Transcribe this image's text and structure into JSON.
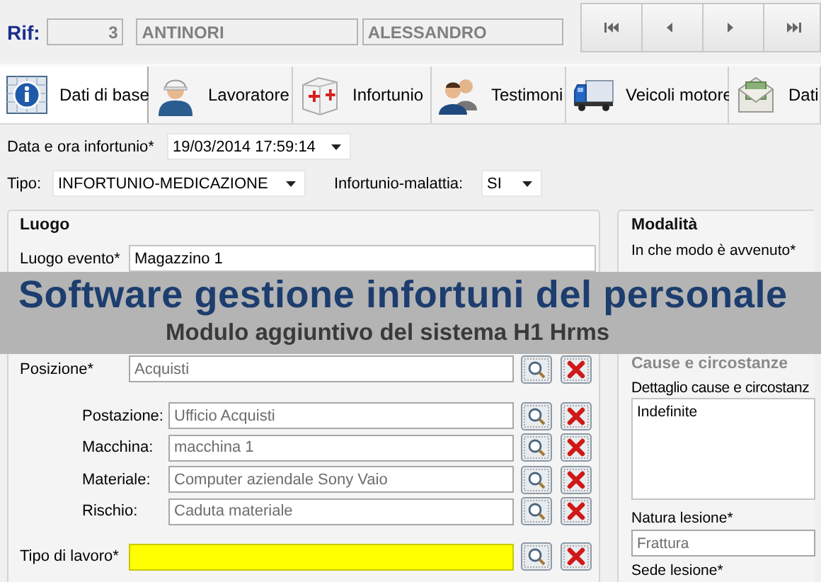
{
  "header": {
    "label": "Rif:",
    "number": "3",
    "surname": "ANTINORI",
    "name": "ALESSANDRO",
    "nav": [
      {
        "kind": "first"
      },
      {
        "kind": "prev"
      },
      {
        "kind": "next"
      },
      {
        "kind": "last"
      }
    ]
  },
  "tabs": [
    {
      "label": "Dati di base",
      "selected": true
    },
    {
      "label": "Lavoratore",
      "selected": false
    },
    {
      "label": "Infortunio",
      "selected": false
    },
    {
      "label": "Testimoni",
      "selected": false
    },
    {
      "label": "Veicoli motore",
      "selected": false
    },
    {
      "label": "Dati",
      "selected": false
    }
  ],
  "accident": {
    "date_label": "Data e ora infortunio*",
    "date_value": "19/03/2014 17:59:14",
    "type_label": "Tipo:",
    "type_value": "INFORTUNIO-MEDICAZIONE",
    "illness_label": "Infortunio-malattia:",
    "illness_value": "SI"
  },
  "place": {
    "title": "Luogo",
    "event_label": "Luogo evento*",
    "event_value": "Magazzino 1",
    "position_label": "Posizione*",
    "position_value": "Acquisti",
    "lookups": [
      {
        "label": "Postazione:",
        "value": "Ufficio Acquisti"
      },
      {
        "label": "Macchina:",
        "value": "macchina 1"
      },
      {
        "label": "Materiale:",
        "value": "Computer aziendale  Sony Vaio"
      },
      {
        "label": "Rischio:",
        "value": "Caduta materiale"
      }
    ],
    "work_type_label": "Tipo di lavoro*",
    "work_type_focused": true
  },
  "mode": {
    "title": "Modalità",
    "how_label": "In che modo è avvenuto*"
  },
  "causes": {
    "title": "Cause e circostanze",
    "detail_label": "Dettaglio cause e circostanz",
    "detail_value": "Indefinite",
    "nature_label": "Natura lesione*",
    "nature_value": "Frattura",
    "site_label": "Sede lesione*"
  },
  "banner": {
    "title": "Software gestione infortuni del personale",
    "subtitle": "Modulo aggiuntivo del sistema H1 Hrms"
  }
}
